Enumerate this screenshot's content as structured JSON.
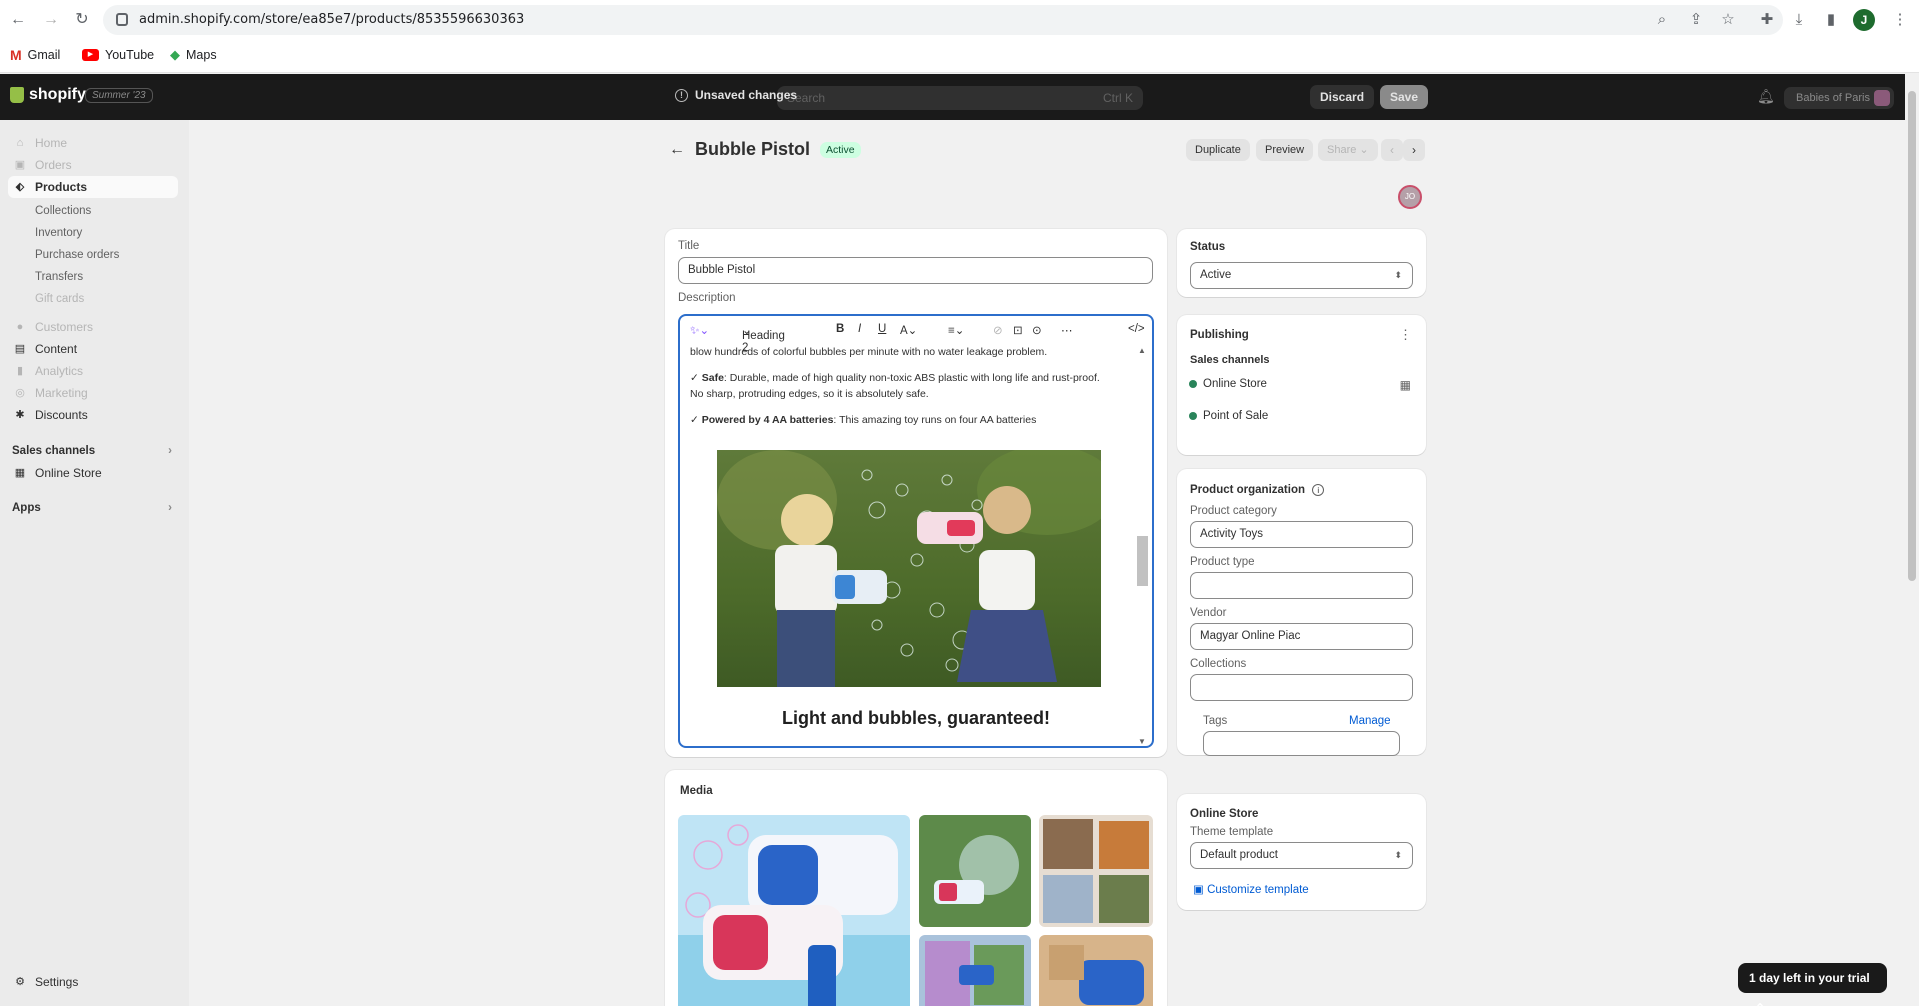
{
  "browser": {
    "url": "admin.shopify.com/store/ea85e7/products/8535596630363",
    "bookmarks": [
      {
        "label": "Gmail",
        "icon": "gmail-icon"
      },
      {
        "label": "YouTube",
        "icon": "youtube-icon"
      },
      {
        "label": "Maps",
        "icon": "maps-icon"
      }
    ],
    "profile_initial": "J"
  },
  "topbar": {
    "brand": "shopify",
    "edition": "Summer '23",
    "search_placeholder": "Search",
    "search_shortcut": "Ctrl K",
    "unsaved_label": "Unsaved changes",
    "discard_label": "Discard",
    "save_label": "Save",
    "store_name": "Babies of Paris"
  },
  "sidebar": {
    "items": [
      {
        "label": "Home"
      },
      {
        "label": "Orders"
      },
      {
        "label": "Products"
      },
      {
        "label": "Collections"
      },
      {
        "label": "Inventory"
      },
      {
        "label": "Purchase orders"
      },
      {
        "label": "Transfers"
      },
      {
        "label": "Gift cards"
      },
      {
        "label": "Customers"
      },
      {
        "label": "Content"
      },
      {
        "label": "Analytics"
      },
      {
        "label": "Marketing"
      },
      {
        "label": "Discounts"
      }
    ],
    "sales_channels_label": "Sales channels",
    "online_store_label": "Online Store",
    "apps_label": "Apps",
    "settings_label": "Settings"
  },
  "page": {
    "title": "Bubble Pistol",
    "status_badge": "Active",
    "duplicate_label": "Duplicate",
    "preview_label": "Preview",
    "share_label": "Share",
    "collaborator_initials": "JO"
  },
  "product": {
    "title_label": "Title",
    "title_value": "Bubble Pistol",
    "description_label": "Description",
    "editor_format": "Heading 2",
    "desc_line1": "blow hundreds of colorful bubbles per minute with no water leakage problem.",
    "safe_bold": "Safe",
    "safe_text": ": Durable, made of high quality non-toxic ABS plastic with long life and rust-proof. No sharp, protruding edges, so it is absolutely safe.",
    "power_bold": "Powered by 4 AA batteries",
    "power_text": ": This amazing toy runs on four AA batteries",
    "heading": "Light and bubbles, guaranteed!",
    "check": "✓"
  },
  "media": {
    "label": "Media"
  },
  "status_card": {
    "title": "Status",
    "value": "Active"
  },
  "publishing": {
    "title": "Publishing",
    "sales_channels_label": "Sales channels",
    "channels": [
      "Online Store",
      "Point of Sale"
    ]
  },
  "organization": {
    "title": "Product organization",
    "category_label": "Product category",
    "category_value": "Activity Toys",
    "type_label": "Product type",
    "type_value": "",
    "vendor_label": "Vendor",
    "vendor_value": "Magyar Online Piac",
    "collections_label": "Collections",
    "collections_value": "",
    "tags_label": "Tags",
    "tags_manage": "Manage",
    "tags_value": ""
  },
  "online_store": {
    "title": "Online Store",
    "theme_label": "Theme template",
    "theme_value": "Default product",
    "customize_label": "Customize template"
  },
  "trial": {
    "label": "1 day left in your trial"
  },
  "colors": {
    "accent": "#005bd3",
    "active_badge": "#cdfee1",
    "topbar": "#1a1a1a",
    "status_dot": "#29845a"
  }
}
